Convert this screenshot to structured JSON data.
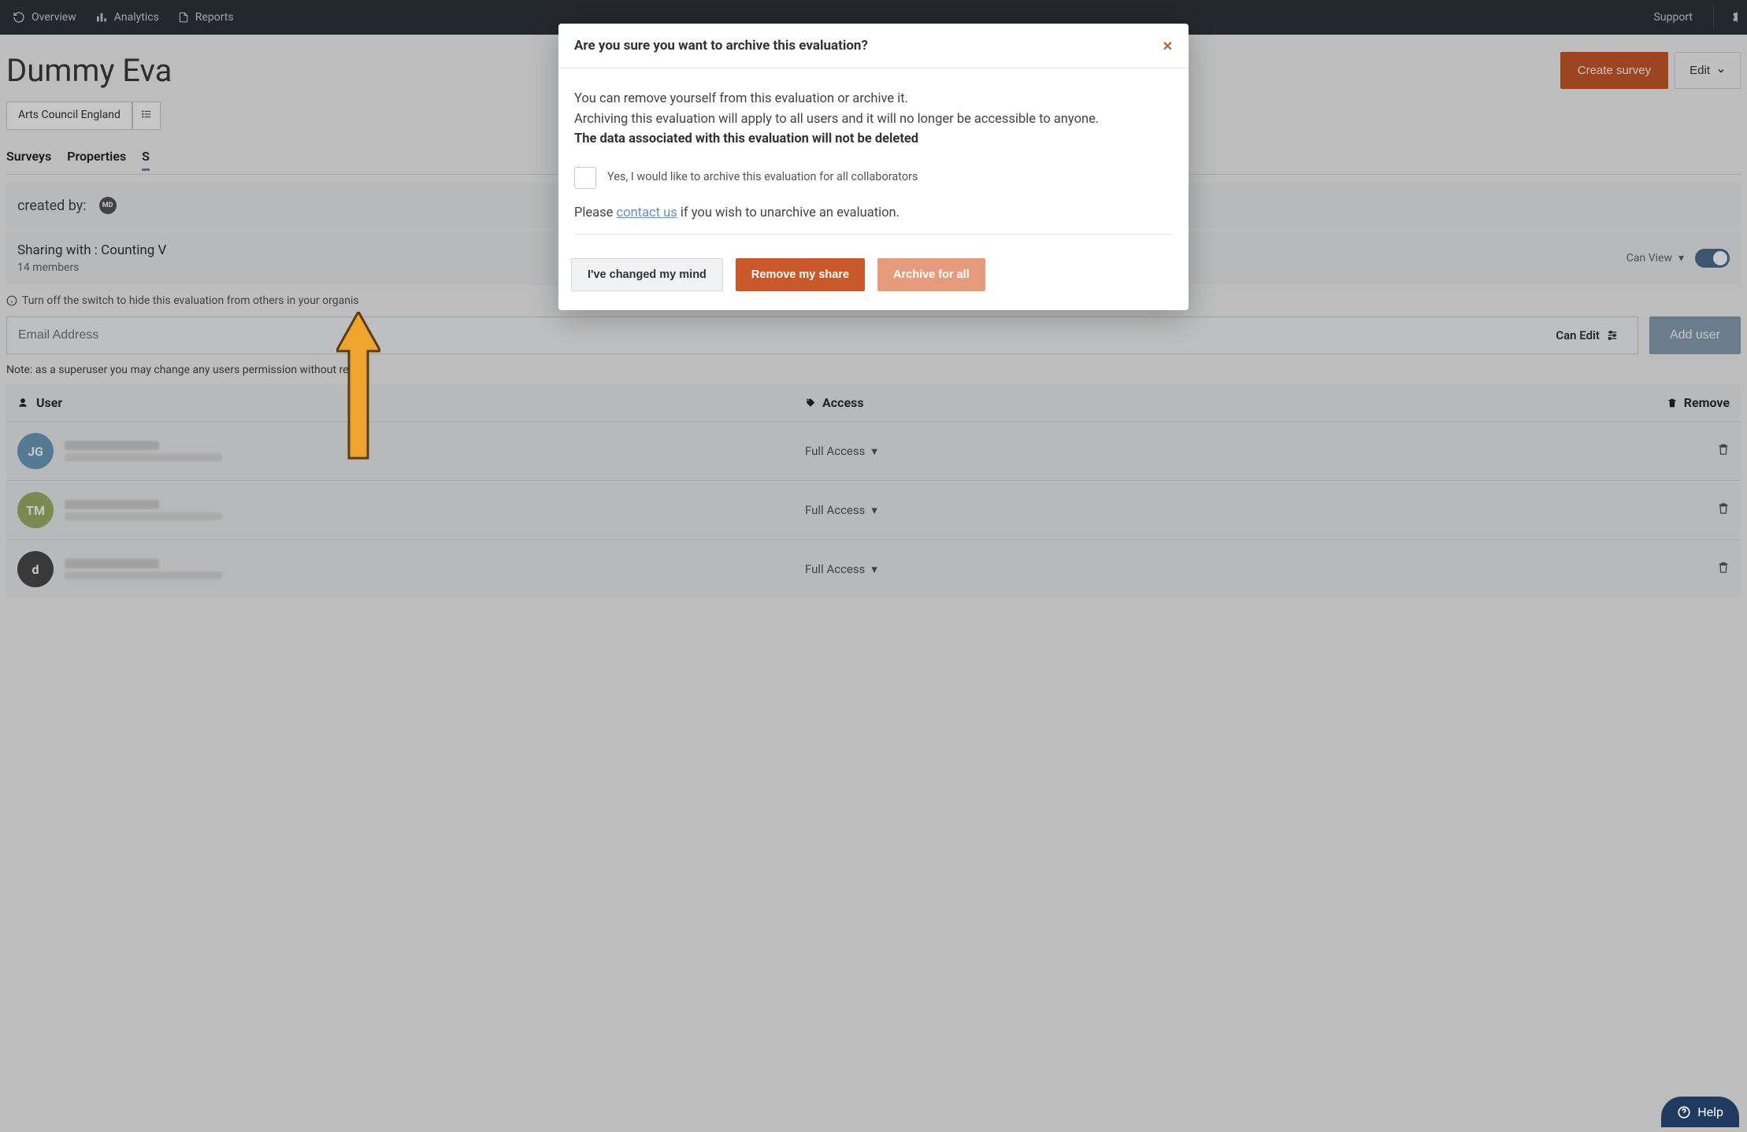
{
  "topbar": {
    "nav": [
      {
        "label": "Overview",
        "icon": "refresh"
      },
      {
        "label": "Analytics",
        "icon": "bars"
      },
      {
        "label": "Reports",
        "icon": "doc"
      }
    ],
    "support": "Support"
  },
  "page": {
    "title": "Dummy Eva",
    "actions": {
      "create": "Create survey",
      "edit": "Edit"
    },
    "chip": "Arts Council England",
    "tabs": [
      "Surveys",
      "Properties",
      "S"
    ],
    "active_tab": 2
  },
  "created": {
    "label": "created by:",
    "initials": "MD"
  },
  "sharing": {
    "title": "Sharing with : Counting V",
    "members": "14 members",
    "can_view": "Can View"
  },
  "hint": "Turn off the switch to hide this evaluation from others in your organis",
  "email": {
    "placeholder": "Email Address",
    "can_edit": "Can Edit",
    "add": "Add user"
  },
  "note": "Note: as a superuser you may change any users permission without restr",
  "table": {
    "headers": {
      "user": "User",
      "access": "Access",
      "remove": "Remove"
    },
    "rows": [
      {
        "initials": "JG",
        "color": "#6e9dbd",
        "access": "Full Access"
      },
      {
        "initials": "TM",
        "color": "#9bb368",
        "access": "Full Access"
      },
      {
        "initials": "d",
        "color": "#4a4a4a",
        "access": "Full Access"
      }
    ]
  },
  "modal": {
    "title": "Are you sure you want to archive this evaluation?",
    "line1": "You can remove yourself from this evaluation or archive it.",
    "line2": "Archiving this evaluation will apply to all users and it will no longer be accessible to anyone.",
    "line3": "The data associated with this evaluation will not be deleted",
    "check_label": "Yes, I would like to archive this evaluation for all collaborators",
    "contact_pre": "Please ",
    "contact_link": "contact us",
    "contact_post": " if you wish to unarchive an evaluation.",
    "buttons": {
      "cancel": "I've changed my mind",
      "remove": "Remove my share",
      "archive": "Archive for all"
    }
  },
  "help": "Help"
}
